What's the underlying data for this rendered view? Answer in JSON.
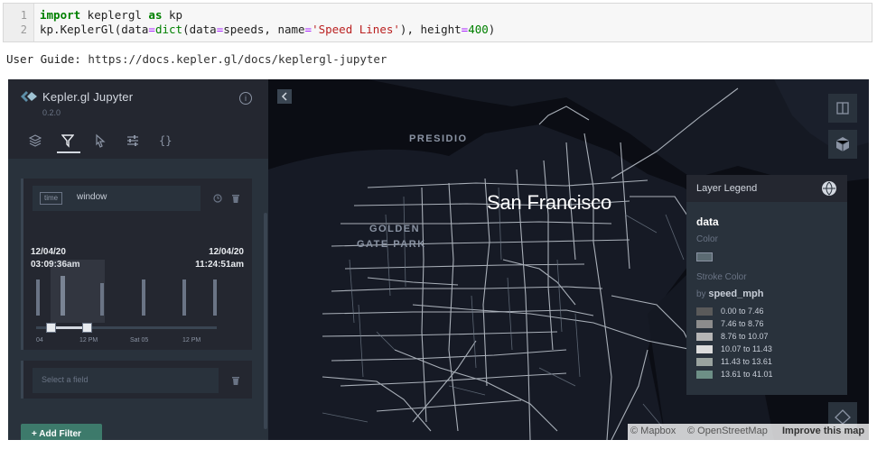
{
  "notebook": {
    "line_numbers": [
      "1",
      "2"
    ],
    "code_line1": {
      "kw": "import",
      "rest": " keplergl ",
      "kw2": "as",
      "tail": " kp"
    },
    "code_line2": {
      "a": "kp.KeplerGl(data",
      "op1": "=",
      "fn": "dict",
      "b": "(data",
      "op2": "=",
      "c": "speeds, name",
      "op3": "=",
      "str": "'Speed Lines'",
      "d": "), height",
      "op4": "=",
      "num": "400",
      "e": ")"
    },
    "guide_label": "User Guide:",
    "guide_link": "https://docs.kepler.gl/docs/keplergl-jupyter"
  },
  "sidebar": {
    "app_title": "Kepler.gl Jupyter",
    "version": "0.2.0",
    "tabs": [
      "layers",
      "filters",
      "interactions",
      "base-map",
      "config"
    ],
    "active_tab": "filters",
    "filter1": {
      "type_tag": "time",
      "field": "window",
      "start_date": "12/04/20",
      "start_time": "03:09:36am",
      "end_date": "12/04/20",
      "end_time": "11:24:51am",
      "ticks": [
        "04",
        "12 PM",
        "Sat 05",
        "12 PM"
      ]
    },
    "filter2": {
      "placeholder": "Select a field"
    },
    "add_filter": "+ Add Filter"
  },
  "map": {
    "labels": {
      "presidio": "PRESIDIO",
      "ggp1": "GOLDEN",
      "ggp2": "GATE PARK",
      "city": "San Francisco"
    },
    "legend": {
      "title": "Layer Legend",
      "layer": "data",
      "color_label": "Color",
      "stroke_label": "Stroke Color",
      "by_label": "by",
      "by_field": "speed_mph",
      "ranges": [
        {
          "label": "0.00 to 7.46",
          "color": "#5a5a5a"
        },
        {
          "label": "7.46 to 8.76",
          "color": "#8c8c8c"
        },
        {
          "label": "8.76 to 10.07",
          "color": "#b5b5b5"
        },
        {
          "label": "10.07 to 11.43",
          "color": "#dcdcdc"
        },
        {
          "label": "11.43 to 13.61",
          "color": "#9aa39f"
        },
        {
          "label": "13.61 to 41.01",
          "color": "#6d8f86"
        }
      ]
    },
    "attribution": {
      "mapbox": "© Mapbox",
      "osm": "© OpenStreetMap",
      "improve": "Improve this map"
    }
  }
}
